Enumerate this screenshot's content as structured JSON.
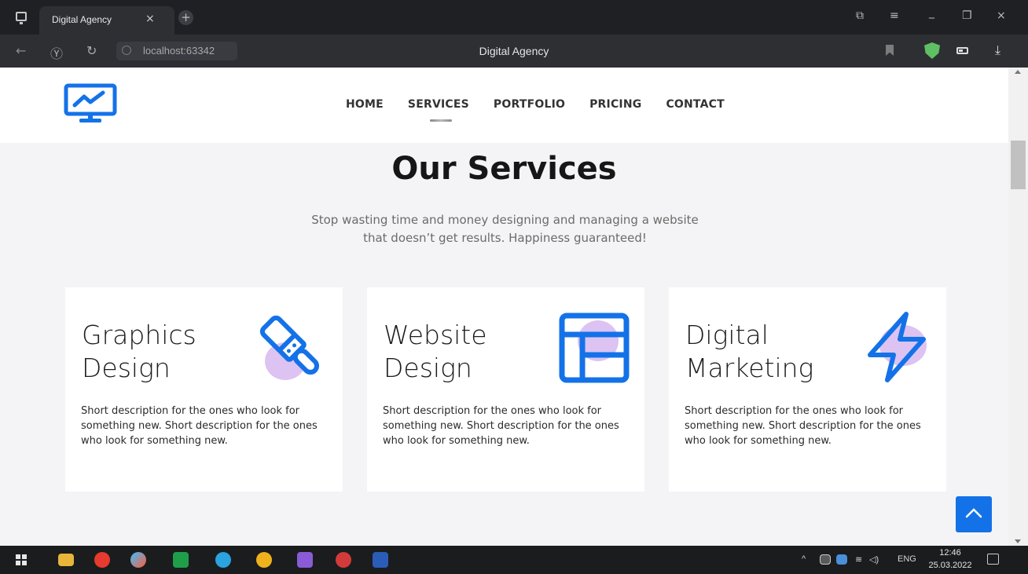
{
  "browser": {
    "tab_title": "Digital Agency",
    "tab_close": "×",
    "new_tab": "+",
    "url": "localhost:63342",
    "page_title": "Digital Agency",
    "win_minimize": "_",
    "win_restore": "❐",
    "win_close": "×",
    "win_menu": "≡",
    "win_collections": "⧉",
    "nav_back": "←",
    "nav_yandex": "Ⓨ",
    "nav_reload": "↻",
    "download": "⤓"
  },
  "nav": {
    "items": [
      {
        "label": "HOME"
      },
      {
        "label": "SERVICES"
      },
      {
        "label": "PORTFOLIO"
      },
      {
        "label": "PRICING"
      },
      {
        "label": "CONTACT"
      }
    ],
    "active": "SERVICES"
  },
  "services": {
    "title": "Our Services",
    "subtitle_line1": "Stop wasting time and money designing and managing a website",
    "subtitle_line2": "that doesn’t get results. Happiness guaranteed!",
    "cards": [
      {
        "title_line1": "Graphics",
        "title_line2": "Design",
        "icon": "paint-brush-icon",
        "description": "Short description for the ones who look for something new. Short description for the ones who look for something new."
      },
      {
        "title_line1": "Website",
        "title_line2": "Design",
        "icon": "layout-icon",
        "description": "Short description for the ones who look for something new. Short description for the ones who look for something new."
      },
      {
        "title_line1": "Digital",
        "title_line2": "Marketing",
        "icon": "lightning-icon",
        "description": "Short description for the ones who look for something new. Short description for the ones who look for something new."
      }
    ]
  },
  "colors": {
    "accent": "#1472e8",
    "blob": "#dcc3f2",
    "page_bg": "#f4f4f6"
  },
  "taskbar": {
    "language": "ENG",
    "time": "12:46",
    "date": "25.03.2022"
  }
}
